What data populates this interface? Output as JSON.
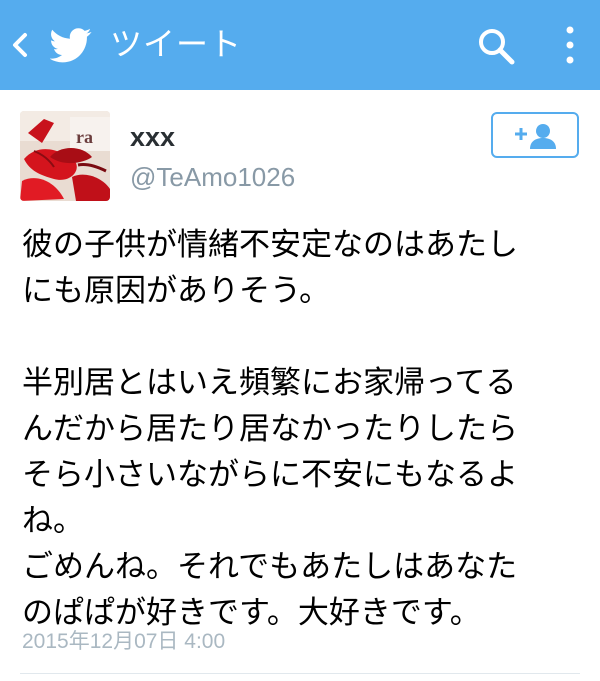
{
  "header": {
    "title": "ツイート",
    "back_icon": "chevron-left-icon",
    "logo_icon": "twitter-bird-icon",
    "search_icon": "search-icon",
    "more_icon": "more-vertical-icon",
    "background_color": "#55acee"
  },
  "tweet": {
    "author": {
      "display_name": "xxx",
      "handle": "@TeAmo1026",
      "avatar_icon": "avatar-photo"
    },
    "follow_button_icon": "add-user-icon",
    "lines": [
      "彼の子供が情緒不安定なのはあたし",
      "にも原因がありそう。",
      "",
      "半別居とはいえ頻繁にお家帰ってる",
      "んだから居たり居なかったりしたら",
      "そら小さいながらに不安にもなるよ",
      "ね。",
      "ごめんね。それでもあたしはあなた",
      "のぱぱが好きです。大好きです。"
    ],
    "timestamp": "2015年12月07日 4:00"
  }
}
